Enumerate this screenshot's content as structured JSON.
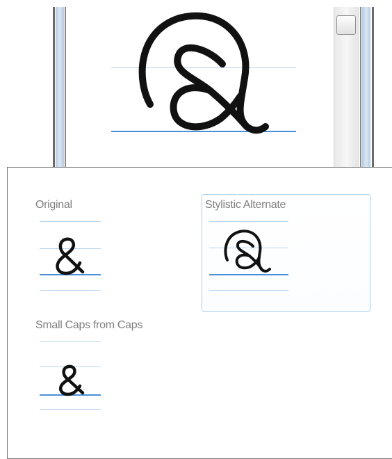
{
  "preview": {
    "glyph_name": "ampersand-stylistic-alternate"
  },
  "popup": {
    "variants": [
      {
        "label": "Original",
        "glyph": "ampersand-original",
        "selected": false
      },
      {
        "label": "Stylistic Alternate",
        "glyph": "ampersand-alternate",
        "selected": true
      },
      {
        "label": "Small Caps from Caps",
        "glyph": "ampersand-small-caps",
        "selected": false
      }
    ]
  },
  "colors": {
    "guide_light": "#b8d4f0",
    "guide_baseline": "#4a90d9",
    "selection_border": "#a9cdef",
    "label_text": "#7f7f7f",
    "frame_blue": "#b6cbe3"
  }
}
